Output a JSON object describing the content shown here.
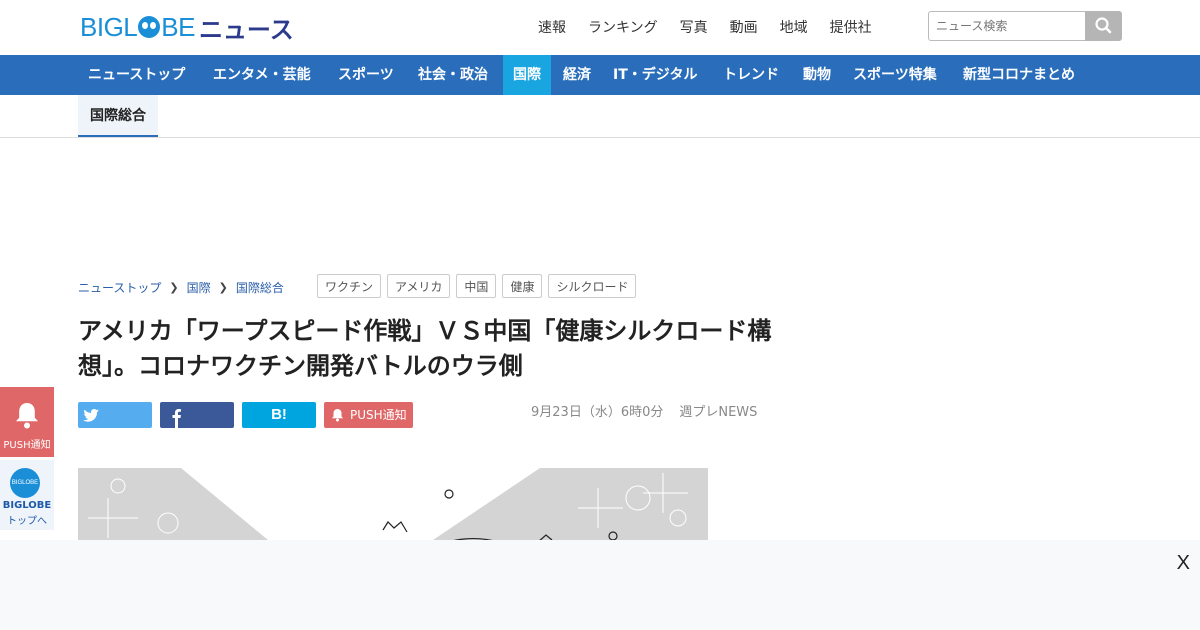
{
  "header": {
    "logo_text": "BIGLOBE",
    "logo_news": "ニュース",
    "top_links": [
      "速報",
      "ランキング",
      "写真",
      "動画",
      "地域",
      "提供社"
    ],
    "search_placeholder": "ニュース検索"
  },
  "nav": {
    "items": [
      {
        "label": "ニューストップ"
      },
      {
        "label": "エンタメ・芸能"
      },
      {
        "label": "スポーツ"
      },
      {
        "label": "社会・政治"
      },
      {
        "label": "国際"
      },
      {
        "label": "経済"
      },
      {
        "label": "IT・デジタル"
      },
      {
        "label": "トレンド"
      },
      {
        "label": "動物"
      },
      {
        "label": "スポーツ特集"
      },
      {
        "label": "新型コロナまとめ"
      }
    ],
    "active_index": 4
  },
  "subnav": {
    "tab": "国際総合"
  },
  "breadcrumb": [
    "ニューストップ",
    "国際",
    "国際総合"
  ],
  "tags": [
    "ワクチン",
    "アメリカ",
    "中国",
    "健康",
    "シルクロード"
  ],
  "article": {
    "title": "アメリカ「ワープスピード作戦」ＶＳ中国「健康シルクロード構想」。コロナワクチン開発バトルのウラ側",
    "date": "9月23日（水）6時0分",
    "source": "週プレNEWS"
  },
  "share": {
    "hatena": "B!",
    "push": "PUSH通知"
  },
  "side": {
    "push_label": "PUSH通知",
    "biglobe_label": "BIGLOBE",
    "biglobe_sub": "トップへ",
    "biglobe_ball": "BIGLOBE"
  },
  "bottom_ad": {
    "close": "X"
  },
  "colors": {
    "nav": "#2a6ebb",
    "nav_active": "#19a5e0",
    "twitter": "#55acee",
    "facebook": "#3b5998",
    "hatena": "#00a4de",
    "push": "#e06767"
  }
}
